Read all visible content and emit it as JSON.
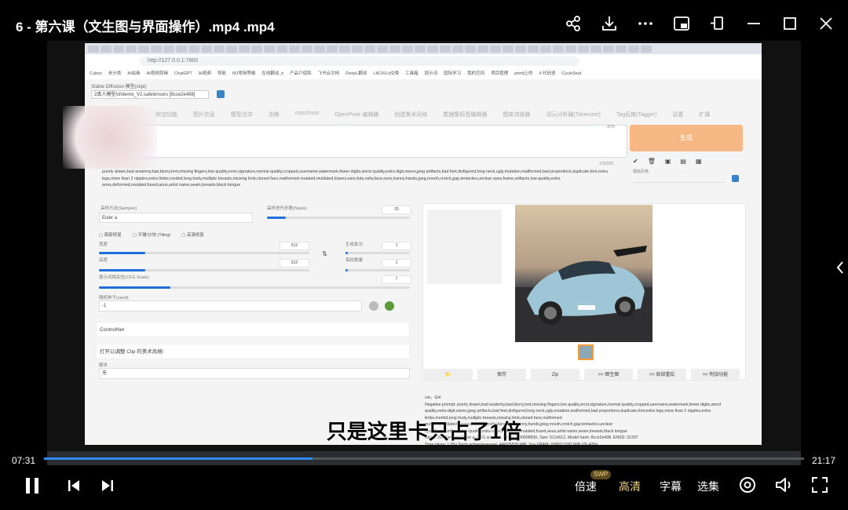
{
  "window": {
    "title": "6 - 第六课（文生图与界面操作）.mp4 .mp4"
  },
  "top_icons": [
    "share-icon",
    "download-icon",
    "more-icon",
    "picture-in-picture-icon",
    "pin-icon",
    "minimize-icon",
    "maximize-icon",
    "close-icon"
  ],
  "browser": {
    "url": "http://127.0.0.1:7860",
    "bookmarks": [
      "Cubox",
      "未分类",
      "AI绘画",
      "AI视频剪辑",
      "ChatGPT",
      "AI视频",
      "导航",
      "MJ常用等格",
      "在线翻译_k",
      "产品介绍和",
      "飞书云文档",
      "DeepL翻译",
      "LACK/Lit交换",
      "工具箱",
      "提示词",
      "国际学习",
      "我的空间",
      "项目管理",
      "print|让你",
      "4.代码语",
      "CycleStud"
    ]
  },
  "sd": {
    "model_label": "Stable Diffusion 模型(ckpt)",
    "model_value": "2真人模型/chilemix_V2.safetensors [8cce2e498]",
    "tabs": [
      "附加功能",
      "图片信息",
      "模型合并",
      "训练",
      "mov2mov",
      "OpenPose 编辑器",
      "创建美术风格",
      "数据集标签编辑器",
      "图库浏览器",
      "词元分析器(Tokenizer)",
      "Tag反推(Tagger)",
      "设置",
      "扩展"
    ],
    "prompt_count": "3/75",
    "neg_count": "175/225",
    "generate_label": "生成",
    "styles_label": "模版风格",
    "negative_prompt": "poorly drawn,bad anatomy,bad,blurry,text,missing fingers,low quality,error,signature,normal quality,cropped,username,watermark,fewer digits,worst quality,extra digit,owres,jpeg artifacts,bad feet,disfigured,long neck,ugly,mutation,malformed,bad proportions,duplicate,font,extra legs,more than 2 nipples,extra limbs,morbid,long body,multiple breasts,missing limb,cloned face,malformed mutated,mutilated,lowers,ears,futa,nsfw,face,eyes,tranny,hands,jpeg,mouth,crotch,gap,tentacles,unclear eyes,frame,artifacts,low-quality,extra arms,deformed,mutated,fused,anus,artist name,seam,breasts,black tongue",
    "sampler_label": "采样方法(Sampler)",
    "sampler_value": "Euler a",
    "steps_label": "采样迭代步数(Steps)",
    "steps_value": "20",
    "steps_fraction": 0.13,
    "checkbox_labels": [
      "面部修复",
      "平铺/分块 (Tiling)",
      "高清修复"
    ],
    "width_label": "宽度",
    "width_value": "512",
    "width_fraction": 0.22,
    "height_label": "高度",
    "height_value": "512",
    "height_fraction": 0.22,
    "swap_icon": "swap-icon",
    "batch_count_label": "生成批次",
    "batch_count_value": "1",
    "batch_size_label": "每批数量",
    "batch_size_value": "1",
    "cfg_label": "提示词相关性(CFG Scale)",
    "cfg_value": "7",
    "cfg_fraction": 0.23,
    "seed_label": "随机种子(seed)",
    "seed_value": "-1",
    "controlnet_label": "ControlNet",
    "clip_label": "打开以调整 Clip 的美术风格!",
    "script_label": "脚本",
    "script_value": "无",
    "output_buttons": [
      "📁",
      "保存",
      "Zip",
      ">> 图生图",
      ">> 局部重绘",
      ">> 附加功能"
    ],
    "output_text": "car，Girl\nNegative prompt: poorly drawn,bad anatomy,bad,blurry,text,missing fingers,low quality,error,signature,normal quality,cropped,username,watermark,fewer digits,worst quality,extra digit,owres,jpeg artifacts,bad feet,disfigured,long neck,ugly,mutation,malformed,bad proportions,duplicate,font,extra legs,more than 2 nipples,extra limbs,morbid,long body,multiple breasts,missing limb,cloned face,malformed mutated,mutilated,lowers,ears,futa,nsfw,face,eyes,tranny,hands,jpeg,mouth,crotch,gap,tentacles,unclear\neyes,frame,artifacts,low-quality,extra arms,deformed,mutated,fused,anus,artist name,seam,breasts,black tongue\nSteps: 20, Sampler: Euler a, CFG scale: 7, Seed: 3040998930, Size: 512x512, Model hash: 8cce2e498, ENSD: 31337\nTime taken: 1.55s  Torch active/reserved: 4460/5828 MiB, Sys VRAM: 9386/12282 MiB (76.42%)"
  },
  "subtitle": "只是这里卡只占了1倍",
  "player": {
    "current_time": "07:31",
    "total_time": "21:17",
    "progress": 0.353,
    "speed_label": "倍速",
    "swp_badge": "SWP",
    "quality_label": "高清",
    "subtitle_label": "字幕",
    "episodes_label": "选集"
  },
  "colors": {
    "accent_progress": "#2f8bff",
    "generate_button": "#f6b985",
    "slider": "#1e6fd9"
  }
}
